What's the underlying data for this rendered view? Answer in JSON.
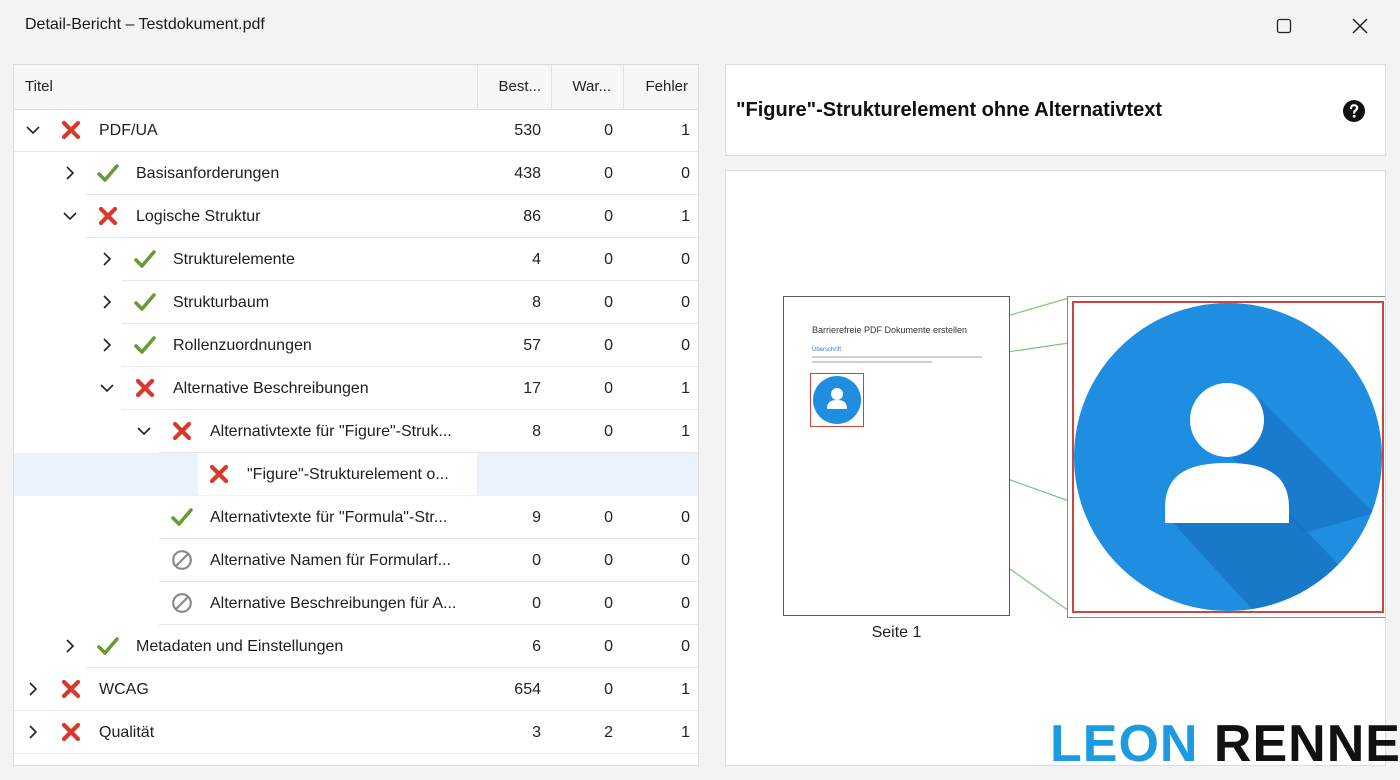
{
  "window": {
    "title": "Detail-Bericht – Testdokument.pdf"
  },
  "tree": {
    "columns": {
      "titel": "Titel",
      "best": "Best...",
      "war": "War...",
      "fehler": "Fehler"
    },
    "rows": [
      {
        "label": "PDF/UA",
        "status": "error",
        "expander": "expanded",
        "best": "530",
        "war": "0",
        "fehler": "1"
      },
      {
        "label": "Basisanforderungen",
        "status": "ok",
        "expander": "collapsed",
        "best": "438",
        "war": "0",
        "fehler": "0"
      },
      {
        "label": "Logische Struktur",
        "status": "error",
        "expander": "expanded",
        "best": "86",
        "war": "0",
        "fehler": "1"
      },
      {
        "label": "Strukturelemente",
        "status": "ok",
        "expander": "collapsed",
        "best": "4",
        "war": "0",
        "fehler": "0"
      },
      {
        "label": "Strukturbaum",
        "status": "ok",
        "expander": "collapsed",
        "best": "8",
        "war": "0",
        "fehler": "0"
      },
      {
        "label": "Rollenzuordnungen",
        "status": "ok",
        "expander": "collapsed",
        "best": "57",
        "war": "0",
        "fehler": "0"
      },
      {
        "label": "Alternative Beschreibungen",
        "status": "error",
        "expander": "expanded",
        "best": "17",
        "war": "0",
        "fehler": "1"
      },
      {
        "label": "Alternativtexte für \"Figure\"-Struk...",
        "status": "error",
        "expander": "expanded",
        "best": "8",
        "war": "0",
        "fehler": "1"
      },
      {
        "label": "\"Figure\"-Strukturelement o...",
        "status": "error",
        "expander": "none",
        "best": "",
        "war": "",
        "fehler": "",
        "selected": true
      },
      {
        "label": "Alternativtexte für \"Formula\"-Str...",
        "status": "ok",
        "expander": "none",
        "best": "9",
        "war": "0",
        "fehler": "0"
      },
      {
        "label": "Alternative Namen für Formularf...",
        "status": "na",
        "expander": "none",
        "best": "0",
        "war": "0",
        "fehler": "0"
      },
      {
        "label": "Alternative Beschreibungen für A...",
        "status": "na",
        "expander": "none",
        "best": "0",
        "war": "0",
        "fehler": "0"
      },
      {
        "label": "Metadaten und Einstellungen",
        "status": "ok",
        "expander": "collapsed",
        "best": "6",
        "war": "0",
        "fehler": "0"
      },
      {
        "label": "WCAG",
        "status": "error",
        "expander": "collapsed",
        "best": "654",
        "war": "0",
        "fehler": "1"
      },
      {
        "label": "Qualität",
        "status": "error",
        "expander": "collapsed",
        "best": "3",
        "war": "2",
        "fehler": "1"
      }
    ]
  },
  "detail": {
    "title": "\"Figure\"-Strukturelement ohne Alternativtext",
    "help_icon": "question-circle-icon"
  },
  "preview": {
    "page_heading": "Barrierefreie PDF Dokumente erstellen",
    "page_subheading": "Überschrift",
    "page_caption": "Seite 1",
    "figure_icon": "user-avatar-icon"
  },
  "brand": {
    "part1": "LEON",
    "part2": "RENNER"
  },
  "colors": {
    "error": "#d9392b",
    "ok": "#6b9a34",
    "na": "#8a8a8a",
    "selection": "#eaf2fb",
    "avatar": "#1f8de0",
    "highlight": "#c9473d",
    "connector": "#7cc67a",
    "brand_blue": "#1d9be1"
  }
}
